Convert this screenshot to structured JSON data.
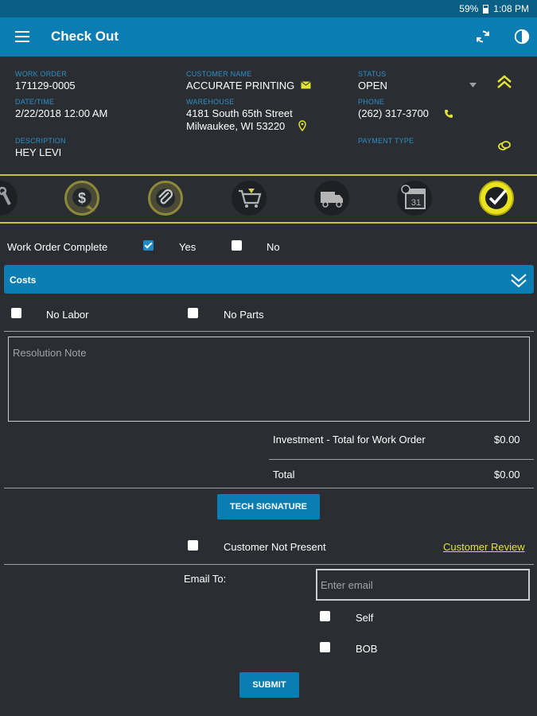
{
  "status_bar": {
    "battery": "59%",
    "time": "1:08 PM"
  },
  "app_bar": {
    "title": "Check Out"
  },
  "header": {
    "work_order_label": "WORK ORDER",
    "work_order": "171129-0005",
    "date_label": "DATE/TIME",
    "date": "2/22/2018 12:00 AM",
    "description_label": "DESCRIPTION",
    "description": "HEY LEVI",
    "customer_label": "CUSTOMER NAME",
    "customer": "ACCURATE PRINTING",
    "warehouse_label": "WAREHOUSE",
    "warehouse_line1": "4181 South 65th Street",
    "warehouse_line2": "Milwaukee, WI 53220",
    "status_label": "STATUS",
    "status": "OPEN",
    "phone_label": "PHONE",
    "phone": "(262) 317-3700",
    "payment_label": "PAYMENT TYPE"
  },
  "icon_bar": {
    "calendar_day": "31",
    "items": [
      "wrench-icon",
      "dollar-chat-icon",
      "paperclip-icon",
      "cart-icon",
      "truck-icon",
      "calendar-icon",
      "checkmark-icon"
    ]
  },
  "work_order_complete": {
    "label": "Work Order Complete",
    "yes": "Yes",
    "no": "No",
    "yes_checked": true
  },
  "costs": {
    "label": "Costs"
  },
  "options": {
    "no_labor": "No Labor",
    "no_parts": "No Parts"
  },
  "resolution": {
    "placeholder": "Resolution Note"
  },
  "totals": {
    "investment_label": "Investment - Total for Work Order",
    "investment_value": "$0.00",
    "total_label": "Total",
    "total_value": "$0.00"
  },
  "tech_signature": "TECH SIGNATURE",
  "customer_not_present": "Customer Not Present",
  "customer_review": "Customer Review",
  "email": {
    "label": "Email To:",
    "placeholder": "Enter email",
    "self": "Self",
    "bob": "BOB"
  },
  "submit": "SUBMIT",
  "colors": {
    "accent": "#0b7db3",
    "background": "#2a2d31",
    "highlight": "#e2e232",
    "label_blue": "#2a90c8"
  }
}
